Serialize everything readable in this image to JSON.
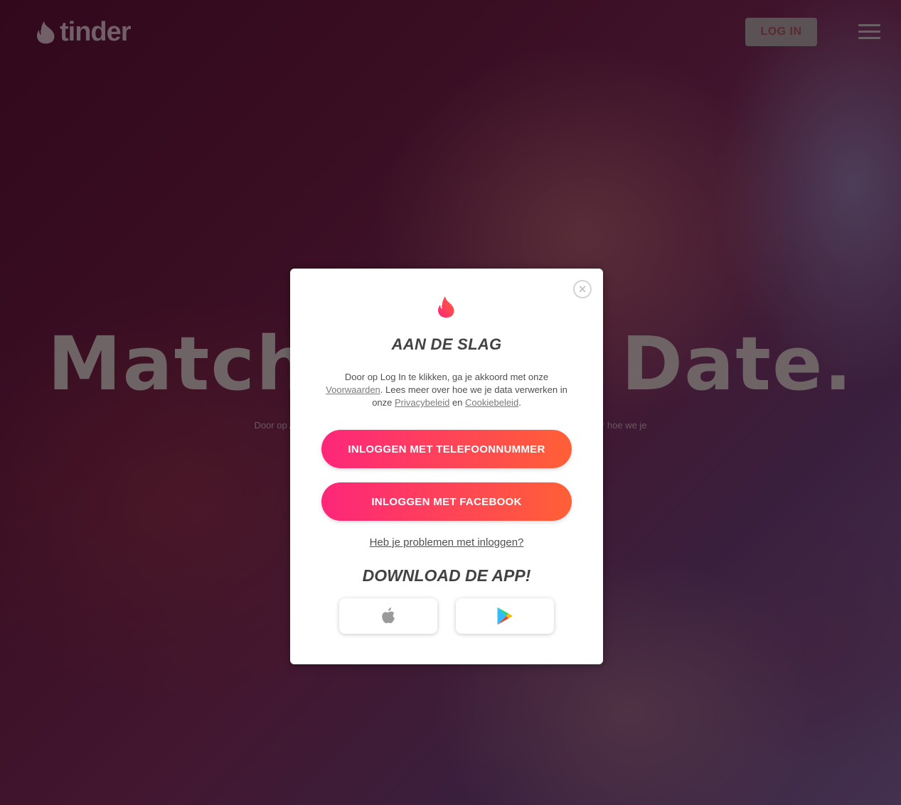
{
  "header": {
    "logo_text": "tinder",
    "login_label": "LOG IN"
  },
  "hero": {
    "title": "Match. Chat. Date.",
    "subtitle": "Door op Aanmelden te klikken, ga je akkoord met onze Voorwaarden. Lees meer over hoe we je"
  },
  "modal": {
    "title": "AAN DE SLAG",
    "terms": {
      "part1": "Door op Log In te klikken, ga je akkoord met onze ",
      "terms_link": "Voorwaarden",
      "part2": ". Lees meer over hoe we je data verwerken in onze ",
      "privacy_link": "Privacybeleid",
      "part3": " en ",
      "cookie_link": "Cookiebeleid",
      "part4": "."
    },
    "phone_button": "INLOGGEN MET TELEFOONNUMMER",
    "facebook_button": "INLOGGEN MET FACEBOOK",
    "trouble_link": "Heb je problemen met inloggen?",
    "download_title": "DOWNLOAD DE APP!",
    "store_icons": [
      "apple-icon",
      "google-play-icon"
    ]
  },
  "colors": {
    "gradient_start": "#fd267a",
    "gradient_end": "#ff6036",
    "title_text": "#424242"
  }
}
